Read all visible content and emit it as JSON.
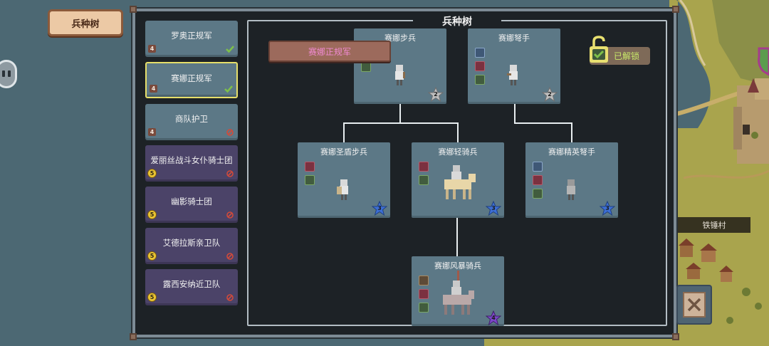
{
  "top_tab": {
    "label": "兵种树"
  },
  "title": "兵种树",
  "sidebar": {
    "items": [
      {
        "label": "罗奥正规军",
        "level": "4",
        "status": "unlocked"
      },
      {
        "label": "赛娜正规军",
        "level": "4",
        "status": "unlocked",
        "selected": true
      },
      {
        "label": "商队护卫",
        "level": "4",
        "status": "locked"
      },
      {
        "label": "爱丽丝战斗女仆骑士团",
        "level": "5",
        "status": "locked"
      },
      {
        "label": "幽影骑士团",
        "level": "5",
        "status": "locked"
      },
      {
        "label": "艾德拉斯亲卫队",
        "level": "5",
        "status": "locked"
      },
      {
        "label": "露西安纳近卫队",
        "level": "5",
        "status": "locked"
      }
    ]
  },
  "faction_banner": "赛娜正规军",
  "unlock_badge": {
    "label": "已解锁"
  },
  "units": {
    "infantry": {
      "name": "赛娜步兵",
      "tier": "2"
    },
    "crossbow": {
      "name": "赛娜弩手",
      "tier": "2"
    },
    "shield": {
      "name": "赛娜圣盾步兵",
      "tier": "3"
    },
    "light_cav": {
      "name": "赛娜轻骑兵",
      "tier": "3"
    },
    "elite_crossbow": {
      "name": "赛娜精英弩手",
      "tier": "3"
    },
    "storm_cav": {
      "name": "赛娜风暴骑兵",
      "tier": "4"
    }
  },
  "village_name": "铁锤村",
  "colors": {
    "unlocked_check": "#7ec04a",
    "locked_mark": "#d24a3a",
    "tier2_star": "#bfbfbf",
    "tier3_star": "#3d6fd6",
    "tier4_star": "#7b46c8",
    "banner_text": "#f08ad2",
    "unlock_text": "#c8e86a"
  }
}
